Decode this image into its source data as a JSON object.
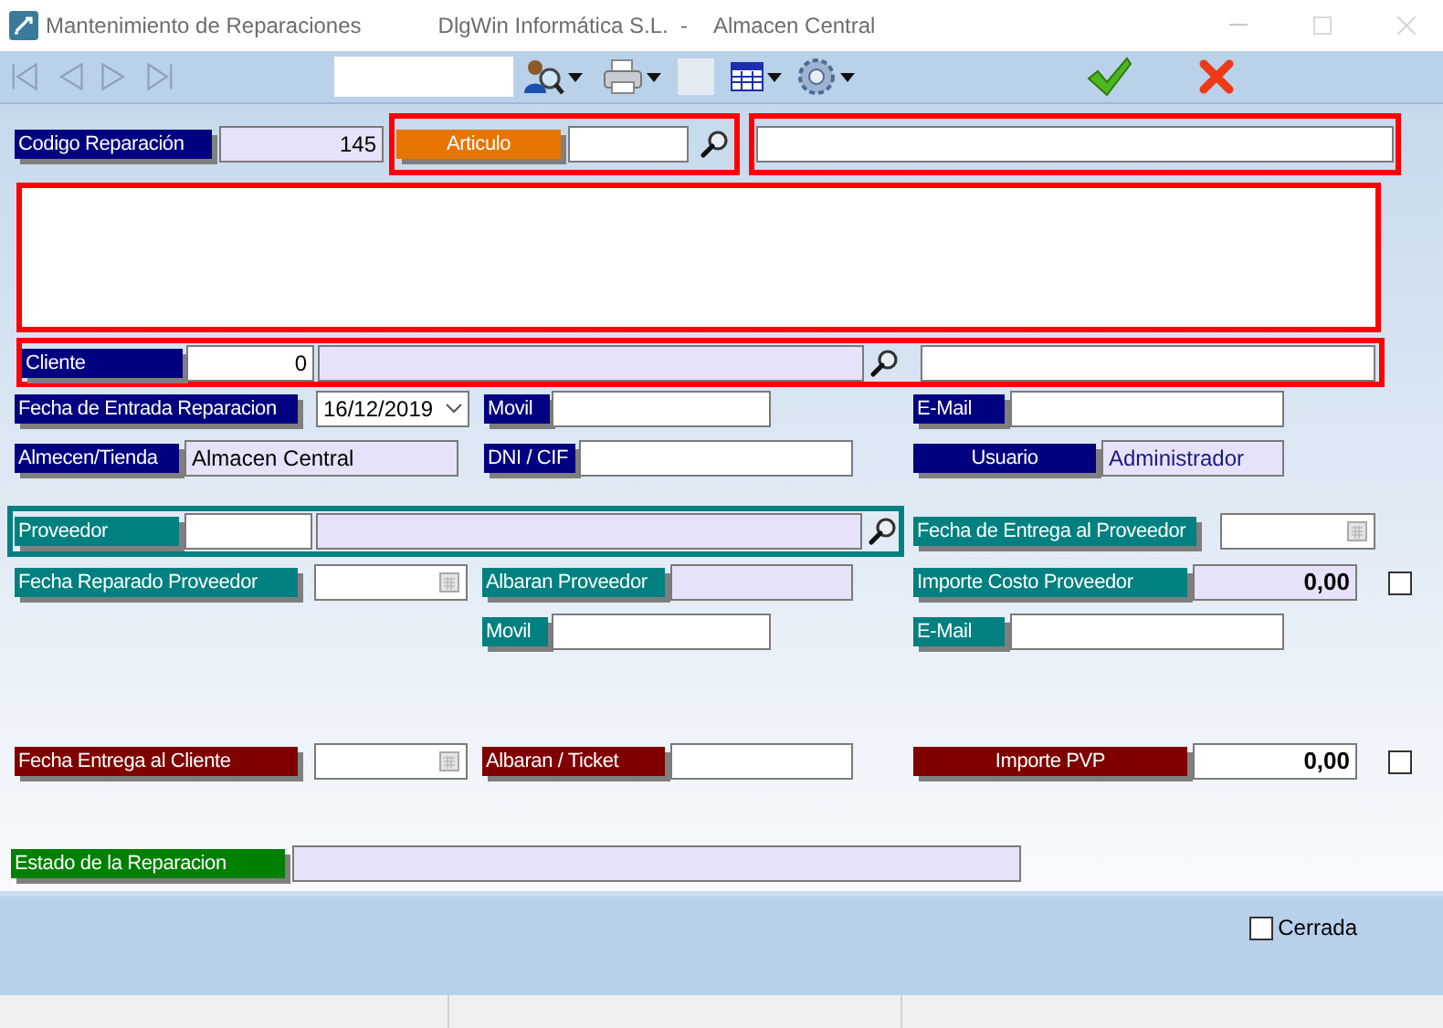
{
  "window": {
    "title": "Mantenimiento de Reparaciones",
    "company": "DlgWin Informática S.L.  -",
    "store": "Almacen Central"
  },
  "fields": [
    {
      "label": "Codigo Reparación",
      "color": "#000080",
      "value": "145"
    },
    {
      "label": "Articulo",
      "color": "#e87400"
    },
    {
      "label": "Cliente",
      "color": "#000080",
      "value": "0"
    },
    {
      "label": "Fecha de Entrada Reparacion",
      "color": "#000080",
      "value": "16/12/2019"
    },
    {
      "label": "Movil",
      "color": "#000080"
    },
    {
      "label": "E-Mail",
      "color": "#000080"
    },
    {
      "label": "Almecen/Tienda",
      "color": "#000080",
      "value": "Almacen Central"
    },
    {
      "label": "DNI / CIF",
      "color": "#000080"
    },
    {
      "label": "Usuario",
      "color": "#000080",
      "value": "Administrador"
    },
    {
      "label": "Proveedor",
      "color": "#008080"
    },
    {
      "label": "Fecha de Entrega al Proveedor",
      "color": "#008080"
    },
    {
      "label": "Fecha Reparado Proveedor",
      "color": "#008080"
    },
    {
      "label": "Albaran Proveedor",
      "color": "#008080"
    },
    {
      "label": "Importe Costo Proveedor",
      "color": "#008080",
      "value": "0,00",
      "checked": false
    },
    {
      "label": "Movil",
      "color": "#008080"
    },
    {
      "label": "E-Mail",
      "color": "#008080"
    },
    {
      "label": "Fecha Entrega al Cliente",
      "color": "#800000"
    },
    {
      "label": "Albaran / Ticket",
      "color": "#800000"
    },
    {
      "label": "Importe PVP",
      "color": "#800000",
      "value": "0,00",
      "checked": false
    },
    {
      "label": "Estado de la Reparacion",
      "color": "#008000"
    }
  ],
  "closed": {
    "label": "Cerrada",
    "checked": false
  }
}
